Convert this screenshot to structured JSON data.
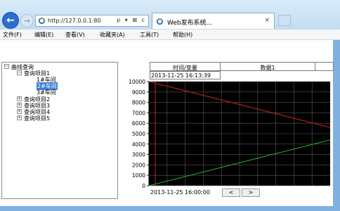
{
  "browser": {
    "address_url": "http://127.0.0.1:80",
    "address_tools": "ρ ▾ ⊠ c",
    "tab_title": "Web发布系统...",
    "tab_close": "×",
    "back_glyph": "←",
    "forward_glyph": "→"
  },
  "menu": [
    "文件(F)",
    "编辑(E)",
    "查看(V)",
    "收藏夹(A)",
    "工具(T)",
    "帮助(H)"
  ],
  "tree": {
    "root": "曲线查询",
    "items": [
      {
        "label": "查询项目1",
        "expanded": true
      },
      {
        "label": "1#车间"
      },
      {
        "label": "2#车间",
        "selected": true
      },
      {
        "label": "3#车间"
      },
      {
        "label": "查询项目2"
      },
      {
        "label": "查询项目3"
      },
      {
        "label": "查询项目4"
      },
      {
        "label": "查询项目5"
      }
    ],
    "expander_minus": "−",
    "expander_plus": "+"
  },
  "grid": {
    "header_time": "时间/变量",
    "header_data": "数据1",
    "cursor_time": "2013-11-25 16:13:39"
  },
  "chart_data": {
    "type": "line",
    "ylim": [
      0,
      10000
    ],
    "yticks": [
      0,
      1000,
      2000,
      3000,
      4000,
      5000,
      6000,
      7000,
      8000,
      9000,
      10000
    ],
    "ytick_labels": [
      "0",
      "1000",
      "2000",
      "3000",
      "4000",
      "5000",
      "6000",
      "7000",
      "8000",
      "9000",
      "10000"
    ],
    "x_start_label": "2013-11-25 16:00:00",
    "x_fraction_range": [
      0,
      1
    ],
    "cursor_x_fraction": 0.035,
    "series": [
      {
        "color": "#cc2020",
        "x": [
          0,
          1
        ],
        "values": [
          10000,
          5600
        ]
      },
      {
        "color": "#22aa22",
        "x": [
          0,
          1
        ],
        "values": [
          0,
          4400
        ]
      }
    ],
    "colors": {
      "background": "#000000",
      "grid": "#5a5a5a",
      "cursor": "#d02020"
    }
  },
  "pager": {
    "prev": "<",
    "next": ">"
  }
}
